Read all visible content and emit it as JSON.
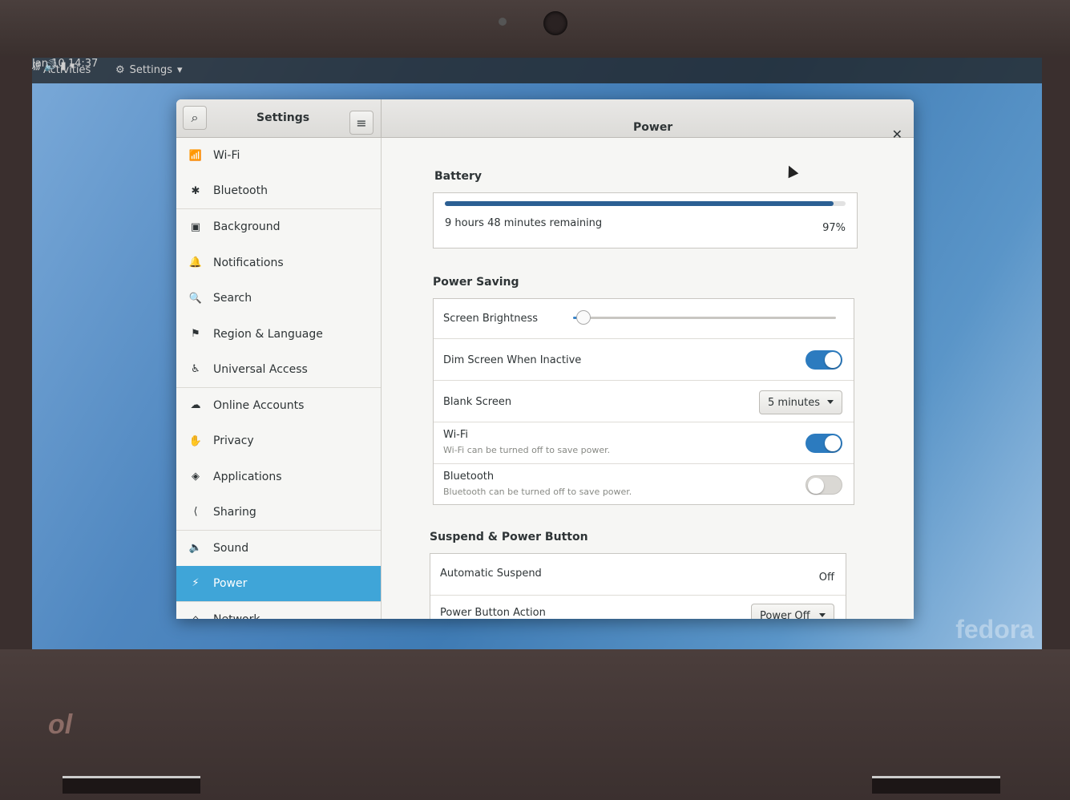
{
  "topbar": {
    "activities": "Activities",
    "app_menu": "Settings",
    "clock": "Jan 10  14:37"
  },
  "settings_title": "Settings",
  "panel_title": "Power",
  "sidebar": {
    "items": [
      {
        "label": "Wi-Fi",
        "icon": "wifi-icon",
        "glyph": "📶"
      },
      {
        "label": "Bluetooth",
        "icon": "bluetooth-icon",
        "glyph": "✱"
      },
      {
        "label": "Background",
        "icon": "background-icon",
        "glyph": "▣"
      },
      {
        "label": "Notifications",
        "icon": "bell-icon",
        "glyph": "🔔"
      },
      {
        "label": "Search",
        "icon": "search-icon",
        "glyph": "🔍"
      },
      {
        "label": "Region & Language",
        "icon": "flag-icon",
        "glyph": "⚑"
      },
      {
        "label": "Universal Access",
        "icon": "accessibility-icon",
        "glyph": "♿"
      },
      {
        "label": "Online Accounts",
        "icon": "cloud-icon",
        "glyph": "☁"
      },
      {
        "label": "Privacy",
        "icon": "hand-icon",
        "glyph": "✋"
      },
      {
        "label": "Applications",
        "icon": "applications-icon",
        "glyph": "◈"
      },
      {
        "label": "Sharing",
        "icon": "share-icon",
        "glyph": "⟨"
      },
      {
        "label": "Sound",
        "icon": "speaker-icon",
        "glyph": "🔈"
      },
      {
        "label": "Power",
        "icon": "power-icon",
        "glyph": "⚡"
      },
      {
        "label": "Network",
        "icon": "network-icon",
        "glyph": "⌂"
      }
    ],
    "active_index": 12
  },
  "battery": {
    "title": "Battery",
    "remaining": "9 hours 48 minutes remaining",
    "percent_label": "97%",
    "level": 0.97
  },
  "power_saving": {
    "title": "Power Saving",
    "screen_brightness_label": "Screen Brightness",
    "brightness_level": 0.04,
    "dim_screen_label": "Dim Screen When Inactive",
    "dim_screen_on": true,
    "blank_screen_label": "Blank Screen",
    "blank_screen_value": "5 minutes",
    "wifi_label": "Wi-Fi",
    "wifi_sub": "Wi-Fi can be turned off to save power.",
    "wifi_on": true,
    "bluetooth_label": "Bluetooth",
    "bluetooth_sub": "Bluetooth can be turned off to save power.",
    "bluetooth_on": false
  },
  "suspend": {
    "title": "Suspend & Power Button",
    "auto_suspend_label": "Automatic Suspend",
    "auto_suspend_value": "Off",
    "power_button_label": "Power Button Action",
    "power_button_value": "Power Off"
  },
  "brand": "fedora",
  "colors": {
    "accent": "#3fa5d8",
    "switch_on": "#2c7bbf",
    "battery_fill": "#2b5f93"
  }
}
